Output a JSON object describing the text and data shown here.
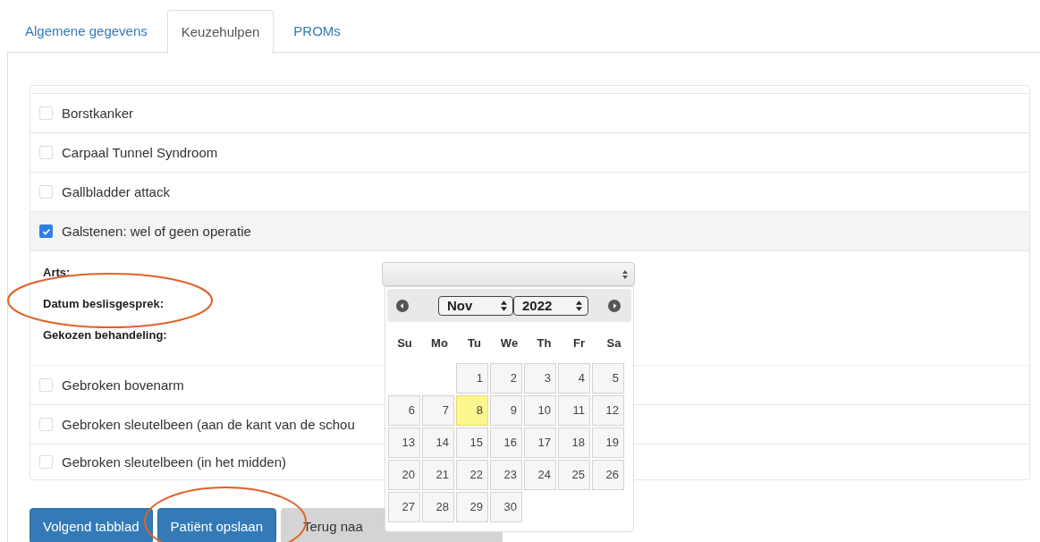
{
  "tabs": [
    {
      "label": "Algemene gegevens",
      "selected": false
    },
    {
      "label": "Keuzehulpen",
      "selected": true
    },
    {
      "label": "PROMs",
      "selected": false
    }
  ],
  "items": [
    {
      "label": "Borstkanker",
      "checked": false
    },
    {
      "label": "Carpaal Tunnel Syndroom",
      "checked": false
    },
    {
      "label": "Gallbladder attack",
      "checked": false
    },
    {
      "label": "Galstenen: wel of geen operatie",
      "checked": true,
      "details": [
        "Arts:",
        "Datum beslisgesprek:",
        "Gekozen behandeling:"
      ]
    },
    {
      "label": "Gebroken bovenarm",
      "checked": false
    },
    {
      "label": "Gebroken sleutelbeen (aan de kant van de schou",
      "checked": false
    },
    {
      "label": "Gebroken sleutelbeen (in het midden)",
      "checked": false
    }
  ],
  "buttons": [
    {
      "label": "Volgend tabblad",
      "kind": "primary"
    },
    {
      "label": "Patiënt opslaan",
      "kind": "primary"
    },
    {
      "label": "Terug naa",
      "kind": "default"
    }
  ],
  "datepicker": {
    "month": "Nov",
    "year": "2022",
    "weekdays": [
      "Su",
      "Mo",
      "Tu",
      "We",
      "Th",
      "Fr",
      "Sa"
    ],
    "weeks": [
      {
        "kind": "lead",
        "days": [
          {
            "day": "1",
            "today": false
          },
          {
            "day": "2",
            "today": false
          },
          {
            "day": "3",
            "today": false
          },
          {
            "day": "4",
            "today": false
          },
          {
            "day": "5",
            "today": false
          }
        ]
      },
      {
        "kind": "full",
        "days": [
          {
            "day": "6",
            "today": false
          },
          {
            "day": "7",
            "today": false
          },
          {
            "day": "8",
            "today": true
          },
          {
            "day": "9",
            "today": false
          },
          {
            "day": "10",
            "today": false
          },
          {
            "day": "11",
            "today": false
          },
          {
            "day": "12",
            "today": false
          }
        ]
      },
      {
        "kind": "full",
        "days": [
          {
            "day": "13",
            "today": false
          },
          {
            "day": "14",
            "today": false
          },
          {
            "day": "15",
            "today": false
          },
          {
            "day": "16",
            "today": false
          },
          {
            "day": "17",
            "today": false
          },
          {
            "day": "18",
            "today": false
          },
          {
            "day": "19",
            "today": false
          }
        ]
      },
      {
        "kind": "full",
        "days": [
          {
            "day": "20",
            "today": false
          },
          {
            "day": "21",
            "today": false
          },
          {
            "day": "22",
            "today": false
          },
          {
            "day": "23",
            "today": false
          },
          {
            "day": "24",
            "today": false
          },
          {
            "day": "25",
            "today": false
          },
          {
            "day": "26",
            "today": false
          }
        ]
      },
      {
        "kind": "trail",
        "days": [
          {
            "day": "27",
            "today": false
          },
          {
            "day": "28",
            "today": false
          },
          {
            "day": "29",
            "today": false
          },
          {
            "day": "30",
            "today": false
          }
        ]
      }
    ]
  }
}
